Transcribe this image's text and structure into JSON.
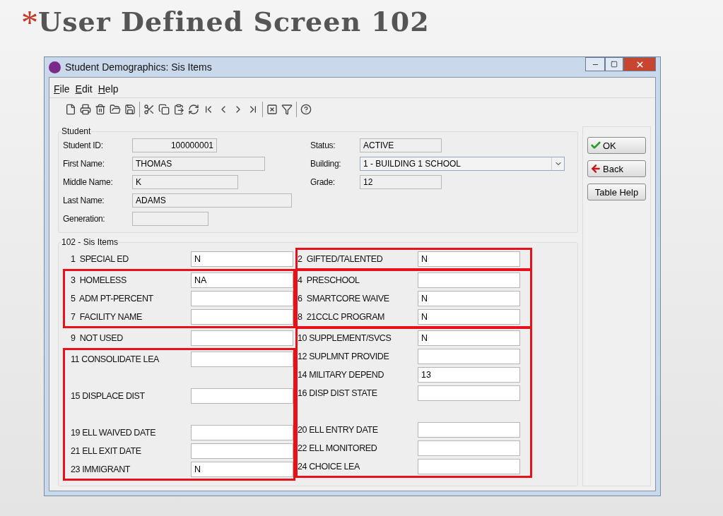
{
  "slide": {
    "bullet": "*",
    "title": "User Defined Screen 102"
  },
  "window": {
    "title": "Student Demographics: Sis Items"
  },
  "menu": [
    {
      "label": "File"
    },
    {
      "label": "Edit"
    },
    {
      "label": "Help"
    }
  ],
  "toolbar": [
    {
      "kind": "new"
    },
    {
      "kind": "print"
    },
    {
      "kind": "delete"
    },
    {
      "kind": "open"
    },
    {
      "kind": "save"
    },
    {
      "kind": "separator"
    },
    {
      "kind": "cut"
    },
    {
      "kind": "copy"
    },
    {
      "kind": "paste"
    },
    {
      "kind": "refresh"
    },
    {
      "kind": "first"
    },
    {
      "kind": "previous"
    },
    {
      "kind": "next"
    },
    {
      "kind": "last"
    },
    {
      "kind": "separator"
    },
    {
      "kind": "close"
    },
    {
      "kind": "filter"
    },
    {
      "kind": "separator"
    },
    {
      "kind": "help"
    }
  ],
  "student": {
    "title": "Student",
    "left": [
      {
        "label": "Student ID:",
        "value": "100000001",
        "kind": "id"
      },
      {
        "label": "First Name:",
        "value": "THOMAS",
        "kind": "wide"
      },
      {
        "label": "Middle Name:",
        "value": "K",
        "kind": "medium"
      },
      {
        "label": "Last Name:",
        "value": "ADAMS",
        "kind": "widest"
      },
      {
        "label": "Generation:",
        "kind": "short"
      }
    ],
    "right": [
      {
        "label": "Status:",
        "value": "ACTIVE",
        "kind": "text"
      },
      {
        "label": "Building:",
        "value": "1 - BUILDING 1 SCHOOL",
        "kind": "dropdown"
      },
      {
        "label": "Grade:",
        "value": "12",
        "kind": "text"
      }
    ]
  },
  "buttons": [
    {
      "label": "OK",
      "kind": "ok"
    },
    {
      "label": "Back",
      "kind": "back"
    },
    {
      "label": "Table Help",
      "kind": "plain"
    }
  ],
  "sis_items": {
    "title": "102 - Sis Items",
    "columns": [
      [
        {
          "highlighted": false,
          "items": [
            {
              "kind": "field",
              "label": "1  SPECIAL ED",
              "value": "N"
            }
          ]
        },
        {
          "highlighted": true,
          "items": [
            {
              "kind": "field",
              "label": "3  HOMELESS",
              "value": "NA"
            },
            {
              "kind": "field",
              "label": "5  ADM PT-PERCENT"
            },
            {
              "kind": "field",
              "label": "7  FACILITY NAME"
            }
          ]
        },
        {
          "highlighted": false,
          "items": [
            {
              "kind": "field",
              "label": "9  NOT USED"
            }
          ]
        },
        {
          "highlighted": true,
          "items": [
            {
              "kind": "field",
              "label": "11 CONSOLIDATE LEA"
            },
            {
              "kind": "blank"
            },
            {
              "kind": "field",
              "label": "15 DISPLACE DIST"
            },
            {
              "kind": "blank"
            },
            {
              "kind": "field",
              "label": "19 ELL WAIVED DATE"
            },
            {
              "kind": "field",
              "label": "21 ELL EXIT DATE"
            },
            {
              "kind": "field",
              "label": "23 IMMIGRANT",
              "value": "N"
            }
          ]
        }
      ],
      [
        {
          "highlighted": true,
          "items": [
            {
              "kind": "field",
              "label": "2  GIFTED/TALENTED",
              "value": "N"
            }
          ]
        },
        {
          "highlighted": true,
          "items": [
            {
              "kind": "field",
              "label": "4  PRESCHOOL"
            },
            {
              "kind": "field",
              "label": "6  SMARTCORE WAIVE",
              "value": "N"
            },
            {
              "kind": "field",
              "label": "8  21CCLC PROGRAM",
              "value": "N"
            }
          ]
        },
        {
          "highlighted": true,
          "items": [
            {
              "kind": "field",
              "label": "10 SUPPLEMENT/SVCS",
              "value": "N"
            },
            {
              "kind": "field",
              "label": "12 SUPLMNT PROVIDE"
            },
            {
              "kind": "field",
              "label": "14 MILITARY DEPEND",
              "value": "13"
            },
            {
              "kind": "field",
              "label": "16 DISP DIST STATE"
            },
            {
              "kind": "blank"
            },
            {
              "kind": "field",
              "label": "20 ELL ENTRY DATE"
            },
            {
              "kind": "field",
              "label": "22 ELL MONITORED"
            },
            {
              "kind": "field",
              "label": "24 CHOICE LEA"
            }
          ]
        }
      ]
    ]
  }
}
